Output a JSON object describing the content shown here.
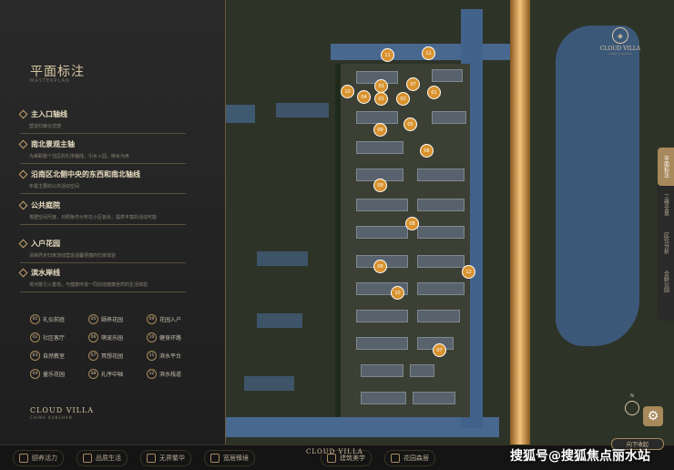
{
  "panel": {
    "title": "平面标注",
    "subtitle": "MASTERPLAN",
    "sections": [
      {
        "title": "主入口轴线",
        "desc": "营造归家仪式感"
      },
      {
        "title": "南北景观主轴",
        "desc": "为串联整个住区的礼序轴线，引水入园，映水为序"
      },
      {
        "title": "沿南区北侧中央的东西和南北轴线",
        "desc": "布置主要的公共活动空间"
      },
      {
        "title": "公共庭院",
        "desc": "根据空间尺度、日照条件分布在小区各处，提供丰富的活动可能"
      },
      {
        "title": "入户花园",
        "desc": "清晰界定归家流线营造温馨便捷的归家体验"
      },
      {
        "title": "滨水岸线",
        "desc": "将河景引入基地，与健康环道一同创造健康自然的生活体验"
      }
    ],
    "legend": [
      {
        "num": "01",
        "label": "礼仪前庭"
      },
      {
        "num": "05",
        "label": "颐养花园"
      },
      {
        "num": "09",
        "label": "花园入户"
      },
      {
        "num": "02",
        "label": "社区客厅"
      },
      {
        "num": "06",
        "label": "萌宠乐园"
      },
      {
        "num": "10",
        "label": "健身环路"
      },
      {
        "num": "03",
        "label": "自然教室"
      },
      {
        "num": "07",
        "label": "冥想花园"
      },
      {
        "num": "11",
        "label": "滨水平台"
      },
      {
        "num": "04",
        "label": "童乐花园"
      },
      {
        "num": "08",
        "label": "礼序中轴"
      },
      {
        "num": "12",
        "label": "滨水栈道"
      }
    ],
    "brand": "CLOUD VILLA",
    "brand_sub": "CHINA KUNSHAN"
  },
  "map": {
    "markers": [
      "11",
      "11",
      "10",
      "04",
      "03",
      "07",
      "01",
      "02",
      "01",
      "05",
      "09",
      "06",
      "09",
      "08",
      "12",
      "08",
      "10",
      "07"
    ]
  },
  "logo": {
    "name": "CLOUD VILLA",
    "sub": "CHINA KUNSHAN"
  },
  "right_tabs": [
    "平面标注",
    "三维全景",
    "区位分析",
    "全龄公园"
  ],
  "north_label": "N",
  "bottom": {
    "items": [
      "颐养活力",
      "品质生活",
      "无界繁华",
      "宽居臻境",
      "建筑美学",
      "花园森居"
    ],
    "brand": "CLOUD VILLA",
    "down_label": "向下收起"
  },
  "watermark": "搜狐号@搜狐焦点丽水站",
  "colors": {
    "accent": "#a8895b",
    "marker": "#d8922e"
  }
}
